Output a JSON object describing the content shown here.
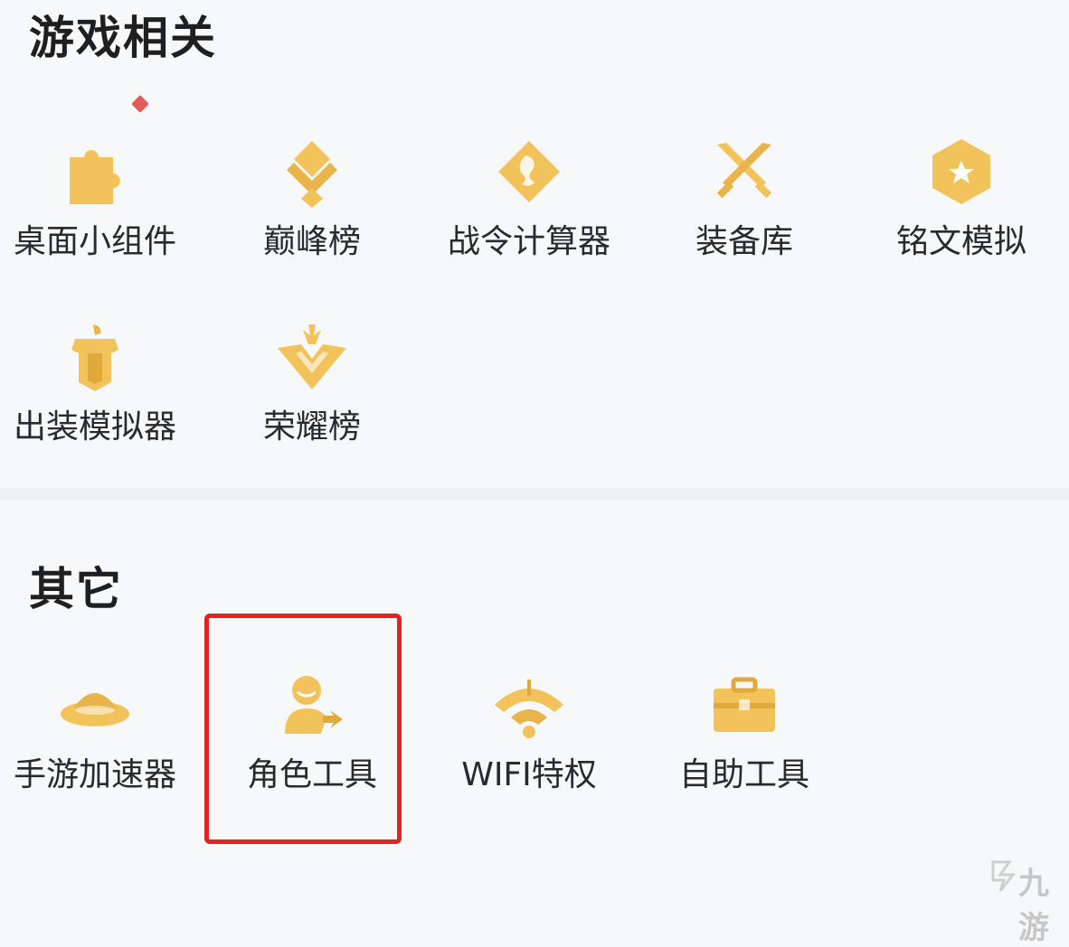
{
  "sections": {
    "game": {
      "title": "游戏相关",
      "items": [
        {
          "label": "桌面小组件",
          "icon": "puzzle-icon"
        },
        {
          "label": "巅峰榜",
          "icon": "diamond-emblem-icon"
        },
        {
          "label": "战令计算器",
          "icon": "dragon-diamond-icon"
        },
        {
          "label": "装备库",
          "icon": "crossed-swords-icon"
        },
        {
          "label": "铭文模拟",
          "icon": "hexagon-star-icon"
        },
        {
          "label": "出装模拟器",
          "icon": "armor-icon"
        },
        {
          "label": "荣耀榜",
          "icon": "crown-badge-icon"
        }
      ]
    },
    "other": {
      "title": "其它",
      "items": [
        {
          "label": "手游加速器",
          "icon": "ufo-icon"
        },
        {
          "label": "角色工具",
          "icon": "user-share-icon"
        },
        {
          "label": "WIFI特权",
          "icon": "wifi-icon"
        },
        {
          "label": "自助工具",
          "icon": "toolbox-icon"
        }
      ]
    }
  },
  "watermark": "九游",
  "colors": {
    "icon_gold": "#f2c35b",
    "icon_gold_dark": "#e0a93a",
    "highlight_red": "#e0251e",
    "badge_red": "#e25b5b"
  }
}
